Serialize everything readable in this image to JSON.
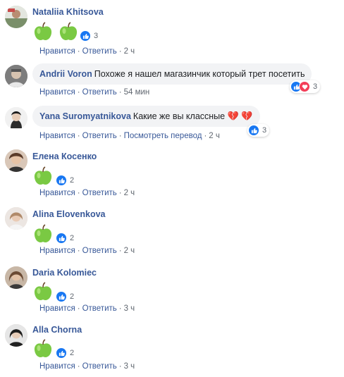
{
  "ui": {
    "like_label": "Нравится",
    "reply_label": "Ответить",
    "translate_label": "Посмотреть перевод",
    "separator": "·"
  },
  "colors": {
    "link": "#385898",
    "bubble_bg": "#f2f3f5",
    "meta": "#606770",
    "like": "#1877f2",
    "love": "#f33e58"
  },
  "comments": [
    {
      "author": "Nataliia Khitsova",
      "sticker": "green-apple-x2",
      "reactions": [
        "like"
      ],
      "reaction_count": "3",
      "time": "2 ч"
    },
    {
      "author": "Andrii Voron",
      "text": "Похоже я нашел магазинчик который трет посетить",
      "reactions": [
        "like",
        "love"
      ],
      "reaction_count": "3",
      "time": "54 мин"
    },
    {
      "author": "Yana Suromyatnikova",
      "text": "Какие же вы классные",
      "emoji": "💔 💔",
      "reactions": [
        "like"
      ],
      "reaction_count": "3",
      "time": "2 ч",
      "show_translate": true
    },
    {
      "author": "Елена Косенко",
      "sticker": "green-apple",
      "reactions": [
        "like"
      ],
      "reaction_count": "2",
      "time": "2 ч"
    },
    {
      "author": "Alina Elovenkova",
      "sticker": "green-apple",
      "reactions": [
        "like"
      ],
      "reaction_count": "2",
      "time": "2 ч"
    },
    {
      "author": "Daria Kolomiec",
      "sticker": "green-apple",
      "reactions": [
        "like"
      ],
      "reaction_count": "2",
      "time": "3 ч"
    },
    {
      "author": "Alla Chorna",
      "sticker": "green-apple",
      "reactions": [
        "like"
      ],
      "reaction_count": "2",
      "time": "3 ч"
    }
  ]
}
